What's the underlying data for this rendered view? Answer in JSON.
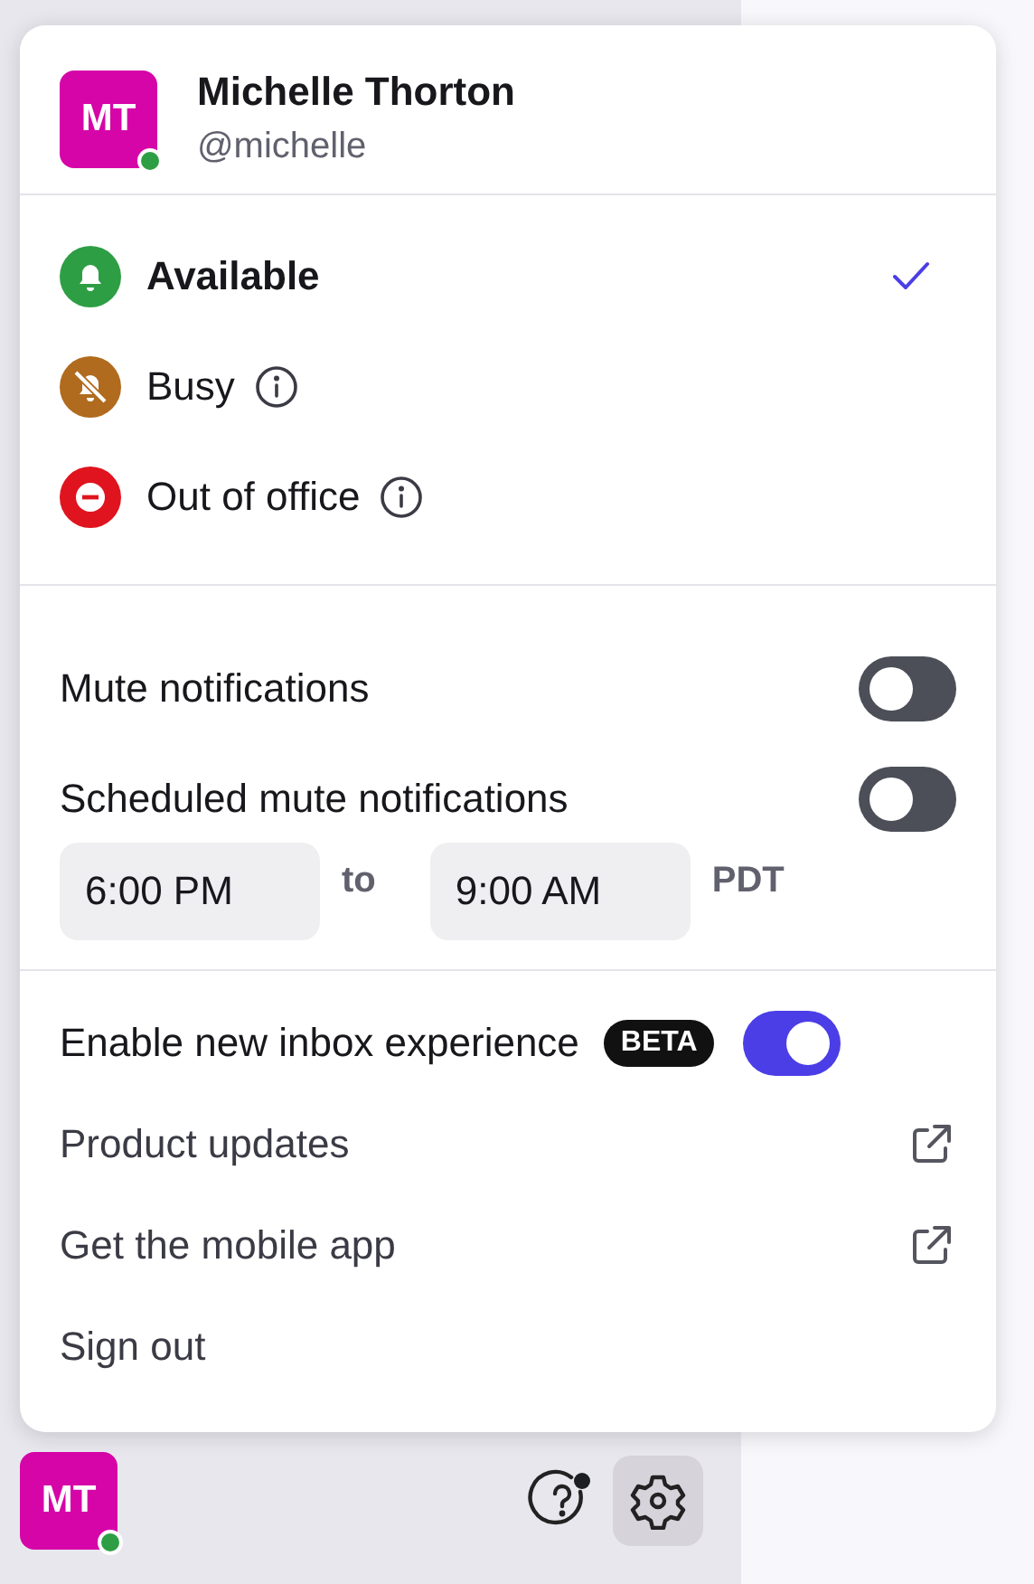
{
  "profile": {
    "initials": "MT",
    "name": "Michelle Thorton",
    "handle": "@michelle",
    "online": true
  },
  "statuses": [
    {
      "kind": "available",
      "label": "Available",
      "selected": true,
      "info": false
    },
    {
      "kind": "busy",
      "label": "Busy",
      "selected": false,
      "info": true
    },
    {
      "kind": "out_of_office",
      "label": "Out of office",
      "selected": false,
      "info": true
    }
  ],
  "notifications": [
    {
      "label": "Mute notifications",
      "on": false
    },
    {
      "label": "Scheduled mute notifications",
      "on": false
    }
  ],
  "schedule": {
    "from": "6:00 PM",
    "separator": "to",
    "until": "9:00 AM",
    "timezone": "PDT"
  },
  "menu": [
    {
      "kind": "toggle",
      "label": "Enable new inbox experience",
      "badge": "BETA",
      "on": true
    },
    {
      "kind": "link",
      "label": "Product updates",
      "external": true
    },
    {
      "kind": "link",
      "label": "Get the mobile app",
      "external": true
    },
    {
      "kind": "link",
      "label": "Sign out",
      "external": false
    }
  ],
  "footer": {
    "initials": "MT",
    "online": true,
    "help_unread": true,
    "settings_selected": true
  }
}
